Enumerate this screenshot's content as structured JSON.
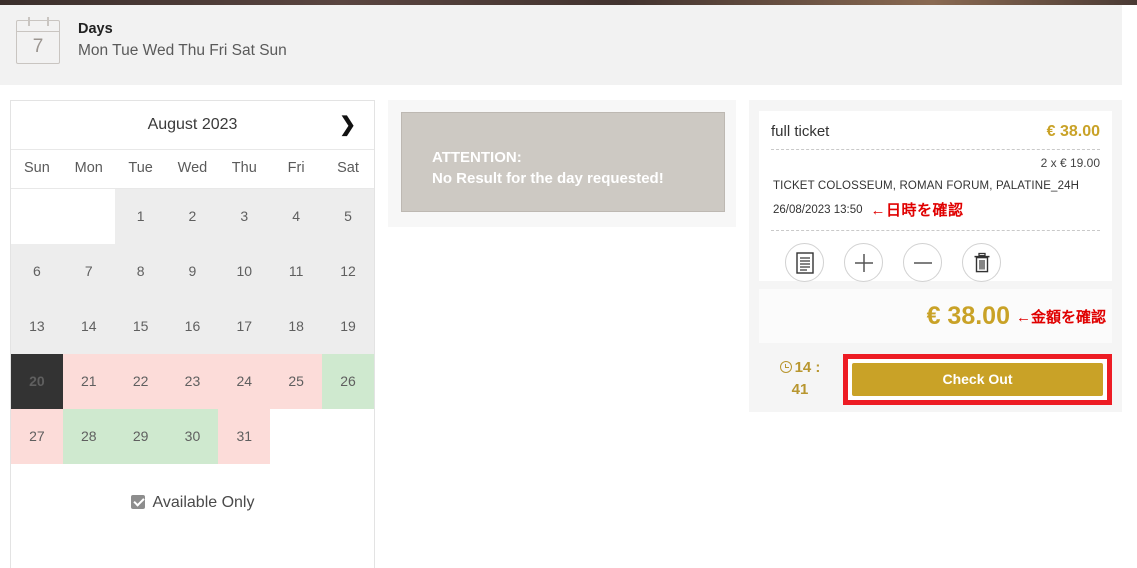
{
  "header": {
    "icon": "calendar-icon",
    "icon_number": "7",
    "title": "Days",
    "days_line": "Mon Tue Wed Thu Fri Sat Sun"
  },
  "calendar": {
    "month_label": "August 2023",
    "next_icon": "❯",
    "weekdays": [
      "Sun",
      "Mon",
      "Tue",
      "Wed",
      "Thu",
      "Fri",
      "Sat"
    ],
    "weeks": [
      [
        {
          "label": "",
          "state": "blank"
        },
        {
          "label": "",
          "state": "blank"
        },
        {
          "label": "1",
          "state": "grey"
        },
        {
          "label": "2",
          "state": "grey"
        },
        {
          "label": "3",
          "state": "grey"
        },
        {
          "label": "4",
          "state": "grey"
        },
        {
          "label": "5",
          "state": "grey"
        }
      ],
      [
        {
          "label": "6",
          "state": "grey"
        },
        {
          "label": "7",
          "state": "grey"
        },
        {
          "label": "8",
          "state": "grey"
        },
        {
          "label": "9",
          "state": "grey"
        },
        {
          "label": "10",
          "state": "grey"
        },
        {
          "label": "11",
          "state": "grey"
        },
        {
          "label": "12",
          "state": "grey"
        }
      ],
      [
        {
          "label": "13",
          "state": "grey"
        },
        {
          "label": "14",
          "state": "grey"
        },
        {
          "label": "15",
          "state": "grey"
        },
        {
          "label": "16",
          "state": "grey"
        },
        {
          "label": "17",
          "state": "grey"
        },
        {
          "label": "18",
          "state": "grey"
        },
        {
          "label": "19",
          "state": "grey"
        }
      ],
      [
        {
          "label": "20",
          "state": "selected"
        },
        {
          "label": "21",
          "state": "red"
        },
        {
          "label": "22",
          "state": "red"
        },
        {
          "label": "23",
          "state": "red"
        },
        {
          "label": "24",
          "state": "red"
        },
        {
          "label": "25",
          "state": "red"
        },
        {
          "label": "26",
          "state": "green"
        }
      ],
      [
        {
          "label": "27",
          "state": "red"
        },
        {
          "label": "28",
          "state": "green"
        },
        {
          "label": "29",
          "state": "green"
        },
        {
          "label": "30",
          "state": "green"
        },
        {
          "label": "31",
          "state": "red"
        },
        {
          "label": "",
          "state": "empty"
        },
        {
          "label": "",
          "state": "empty"
        }
      ]
    ],
    "available_only_label": "Available Only",
    "available_only_checked": true
  },
  "attention": {
    "line1": "ATTENTION:",
    "line2": "No Result for the day requested!"
  },
  "cart": {
    "ticket_name": "full ticket",
    "ticket_price": "€ 38.00",
    "unit_line": "2 x € 19.00",
    "description": "TICKET COLOSSEUM, ROMAN FORUM, PALATINE_24H",
    "datetime": "26/08/2023 13:50",
    "datetime_note": "←日時を確認",
    "actions": [
      {
        "name": "document-icon"
      },
      {
        "name": "plus-icon"
      },
      {
        "name": "minus-icon"
      },
      {
        "name": "trash-icon"
      }
    ],
    "total_amount": "€ 38.00",
    "total_note": "←金額を確認",
    "timer_minutes": "14 :",
    "timer_seconds": "41",
    "checkout_label": "Check Out"
  },
  "colors": {
    "gold": "#c9a227",
    "red_annotation": "#e00000",
    "highlight_box": "#ed1c24",
    "available_green": "#cfe9cf",
    "unavailable_red": "#fcdcd9",
    "selected_day": "#333333"
  }
}
